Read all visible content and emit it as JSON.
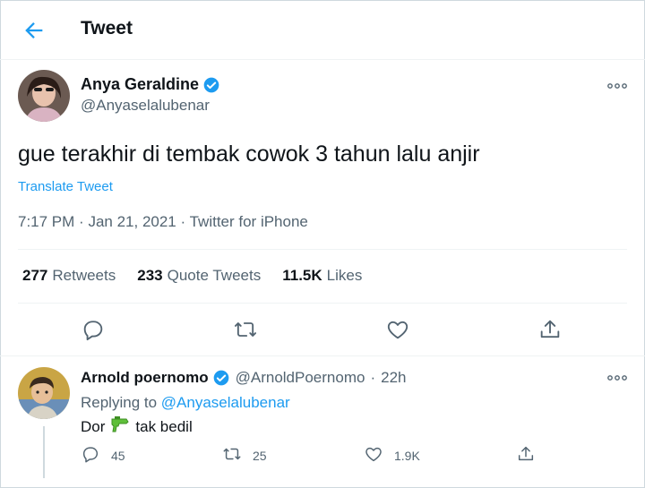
{
  "header": {
    "title": "Tweet"
  },
  "tweet": {
    "author_name": "Anya Geraldine",
    "author_handle": "@Anyaselalubenar",
    "text": "gue terakhir di tembak cowok 3 tahun lalu anjir",
    "translate_label": "Translate Tweet",
    "time": "7:17 PM",
    "date": "Jan 21, 2021",
    "source": "Twitter for iPhone",
    "separator": "·"
  },
  "stats": {
    "retweets_count": "277",
    "retweets_label": "Retweets",
    "quotes_count": "233",
    "quotes_label": "Quote Tweets",
    "likes_count": "11.5K",
    "likes_label": "Likes"
  },
  "reply": {
    "author_name": "Arnold poernomo",
    "author_handle": "@ArnoldPoernomo",
    "time_ago": "22h",
    "separator": "·",
    "replying_prefix": "Replying to",
    "replying_to": "@Anyaselalubenar",
    "text_before": "Dor",
    "emoji": "water-pistol",
    "text_after": "tak bedil",
    "reply_count": "45",
    "retweet_count": "25",
    "like_count": "1.9K"
  },
  "icons": {
    "back": "arrow-left-icon",
    "verified": "verified-badge-icon",
    "more": "more-dots-icon",
    "reply": "reply-icon",
    "retweet": "retweet-icon",
    "like": "heart-icon",
    "share": "share-icon"
  },
  "colors": {
    "accent": "#1d9bf0",
    "text": "#0f1419",
    "muted": "#536471",
    "border": "#eff3f4"
  }
}
